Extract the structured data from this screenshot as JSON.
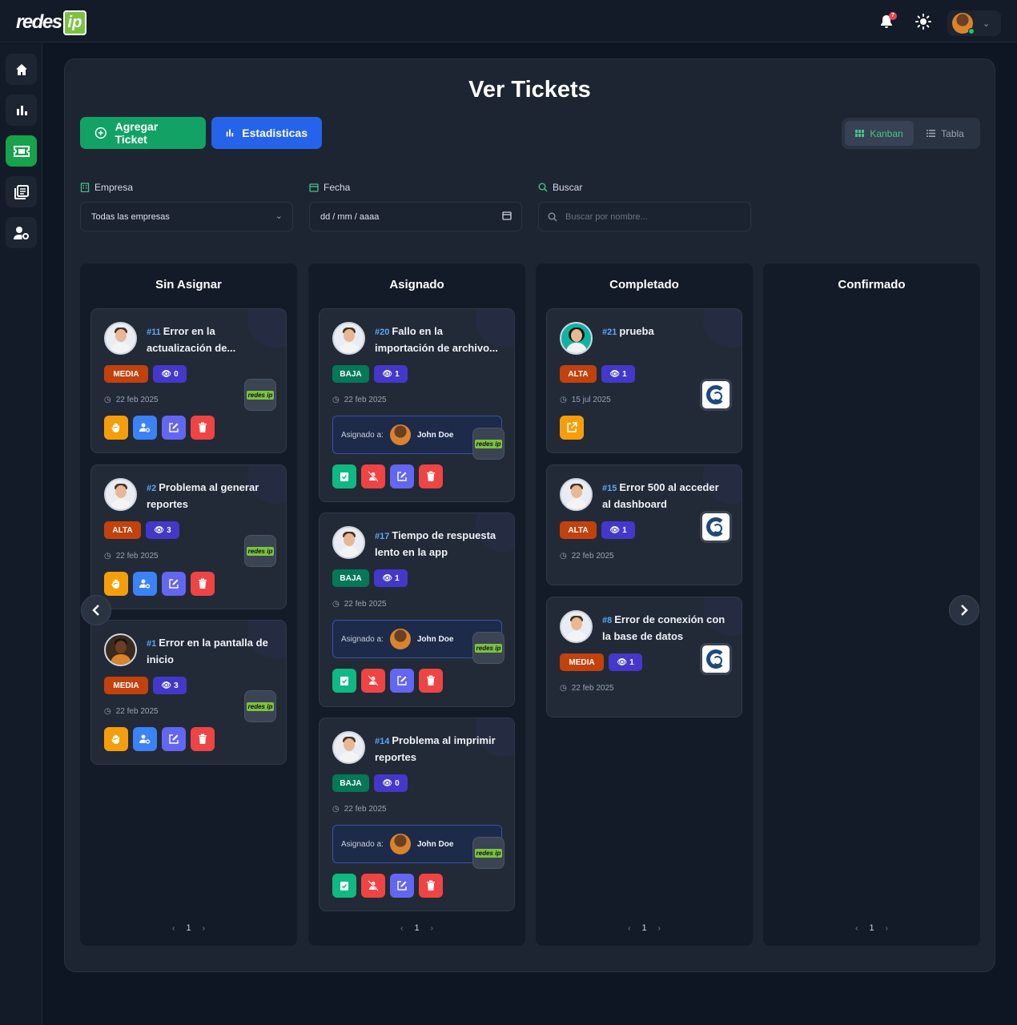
{
  "brand": {
    "logo_text": "redes",
    "logo_ip": "ip"
  },
  "header": {
    "notification_count": "7"
  },
  "page": {
    "title": "Ver Tickets"
  },
  "toolbar": {
    "add_label": "Agregar Ticket",
    "stats_label": "Estadisticas"
  },
  "view": {
    "kanban_label": "Kanban",
    "table_label": "Tabla",
    "active": "Kanban"
  },
  "filters": {
    "empresa_label": "Empresa",
    "empresa_value": "Todas las empresas",
    "fecha_label": "Fecha",
    "fecha_value": "dd / mm / aaaa",
    "buscar_label": "Buscar",
    "buscar_placeholder": "Buscar por nombre..."
  },
  "columns": [
    {
      "title": "Sin Asignar",
      "page": "1",
      "cards": [
        {
          "num": "#11",
          "title": "Error en la actualización de...",
          "priority": "MEDIA",
          "views": "0",
          "date": "22 feb 2025"
        },
        {
          "num": "#2",
          "title": "Problema al generar reportes",
          "priority": "ALTA",
          "views": "3",
          "date": "22 feb 2025"
        },
        {
          "num": "#1",
          "title": "Error en la pantalla de inicio",
          "priority": "MEDIA",
          "views": "3",
          "date": "22 feb 2025"
        }
      ]
    },
    {
      "title": "Asignado",
      "page": "1",
      "cards": [
        {
          "num": "#20",
          "title": "Fallo en la importación de archivo...",
          "priority": "BAJA",
          "views": "1",
          "date": "22 feb 2025",
          "assigned_label": "Asignado a:",
          "assignee": "John Doe"
        },
        {
          "num": "#17",
          "title": "Tiempo de respuesta lento en la app",
          "priority": "BAJA",
          "views": "1",
          "date": "22 feb 2025",
          "assigned_label": "Asignado a:",
          "assignee": "John Doe"
        },
        {
          "num": "#14",
          "title": "Problema al imprimir reportes",
          "priority": "BAJA",
          "views": "0",
          "date": "22 feb 2025",
          "assigned_label": "Asignado a:",
          "assignee": "John Doe"
        }
      ]
    },
    {
      "title": "Completado",
      "page": "1",
      "cards": [
        {
          "num": "#21",
          "title": "prueba",
          "priority": "ALTA",
          "views": "1",
          "date": "15 jul 2025"
        },
        {
          "num": "#15",
          "title": "Error 500 al acceder al dashboard",
          "priority": "ALTA",
          "views": "1",
          "date": "22 feb 2025"
        },
        {
          "num": "#8",
          "title": "Error de conexión con la base de datos",
          "priority": "MEDIA",
          "views": "1",
          "date": "22 feb 2025"
        }
      ]
    },
    {
      "title": "Confirmado",
      "page": "1",
      "cards": []
    }
  ],
  "colors": {
    "accent_green": "#13a266",
    "accent_blue": "#2563eb",
    "alta": "#c2410c",
    "media": "#c2410c",
    "baja": "#047857"
  }
}
